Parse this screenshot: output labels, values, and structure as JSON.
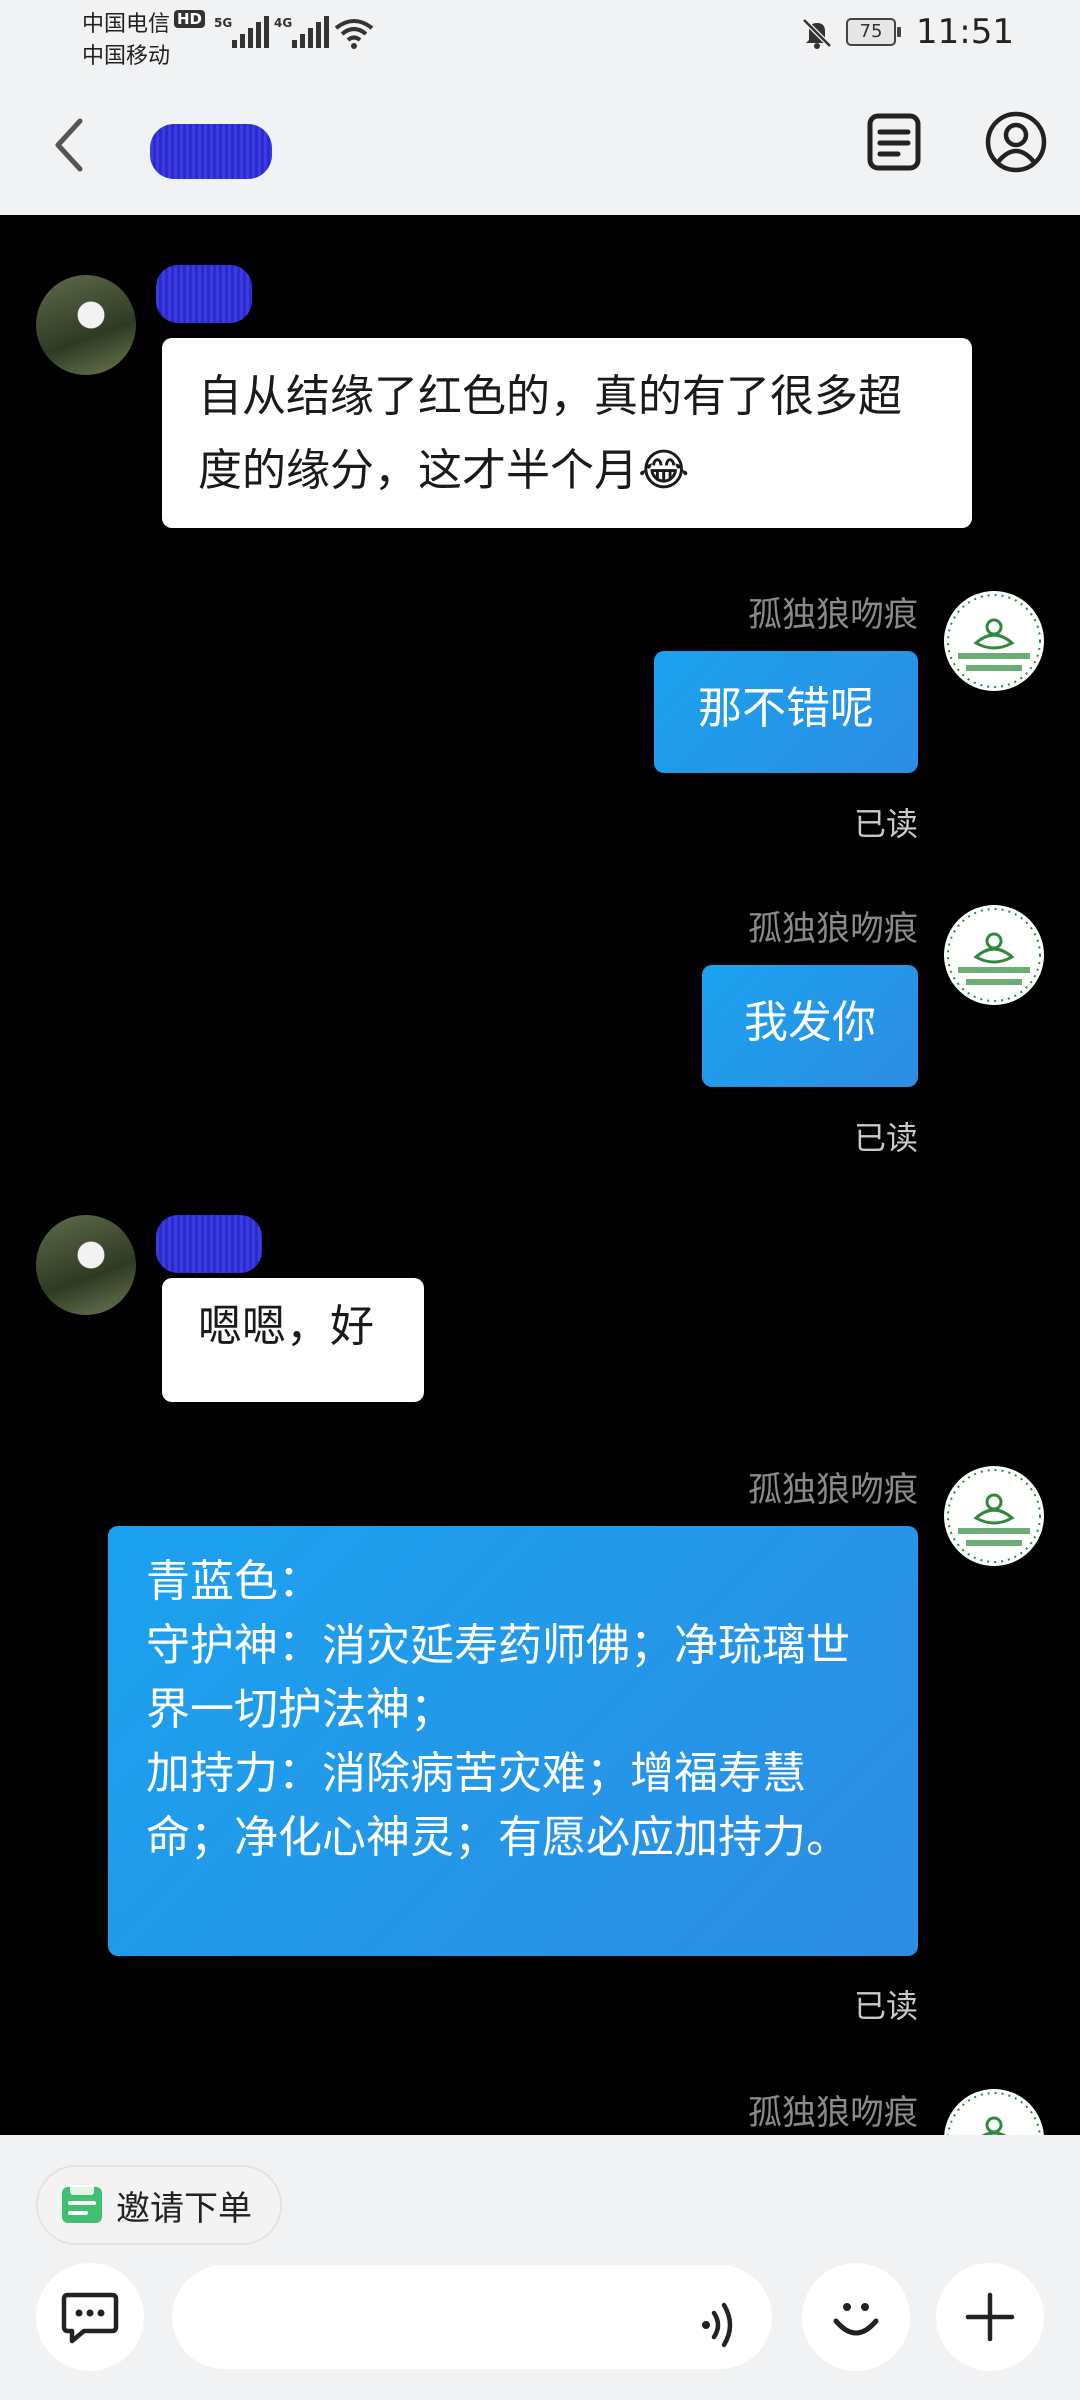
{
  "status_bar": {
    "carrier1": "中国电信",
    "carrier2": "中国移动",
    "hd": "HD",
    "net1": "5G",
    "net2": "4G",
    "battery": "75",
    "time": "11:51"
  },
  "header": {
    "back_icon": "chevron-left-icon",
    "doc_icon": "document-list-icon",
    "profile_icon": "user-profile-icon"
  },
  "messages": [
    {
      "side": "left",
      "text": "自从结缘了红色的，真的有了很多超度的缘分，这才半个月😂"
    },
    {
      "side": "right",
      "sender": "孤独狼吻痕",
      "text": "那不错呢",
      "status": "已读"
    },
    {
      "side": "right",
      "sender": "孤独狼吻痕",
      "text": "我发你",
      "status": "已读"
    },
    {
      "side": "left",
      "text": "嗯嗯，好"
    },
    {
      "side": "right",
      "sender": "孤独狼吻痕",
      "text": "青蓝色：\n守护神：消灾延寿药师佛；净琉璃世界一切护法神；\n加持力：消除病苦灾难；增福寿慧命；净化心神灵；有愿必应加持力。",
      "status": "已读"
    },
    {
      "side": "right",
      "sender": "孤独狼吻痕"
    }
  ],
  "bottom": {
    "invite_label": "邀请下单",
    "invite_icon": "order-icon",
    "chat_icon": "chat-bubble-icon",
    "voice_icon": "voice-wave-icon",
    "emoji_icon": "smiley-icon",
    "plus_icon": "plus-icon"
  },
  "colors": {
    "chat_bg": "#000000",
    "bubble_blue": "#1aa2ee",
    "bubble_white": "#ffffff",
    "header_bg": "#f1f2f4"
  }
}
